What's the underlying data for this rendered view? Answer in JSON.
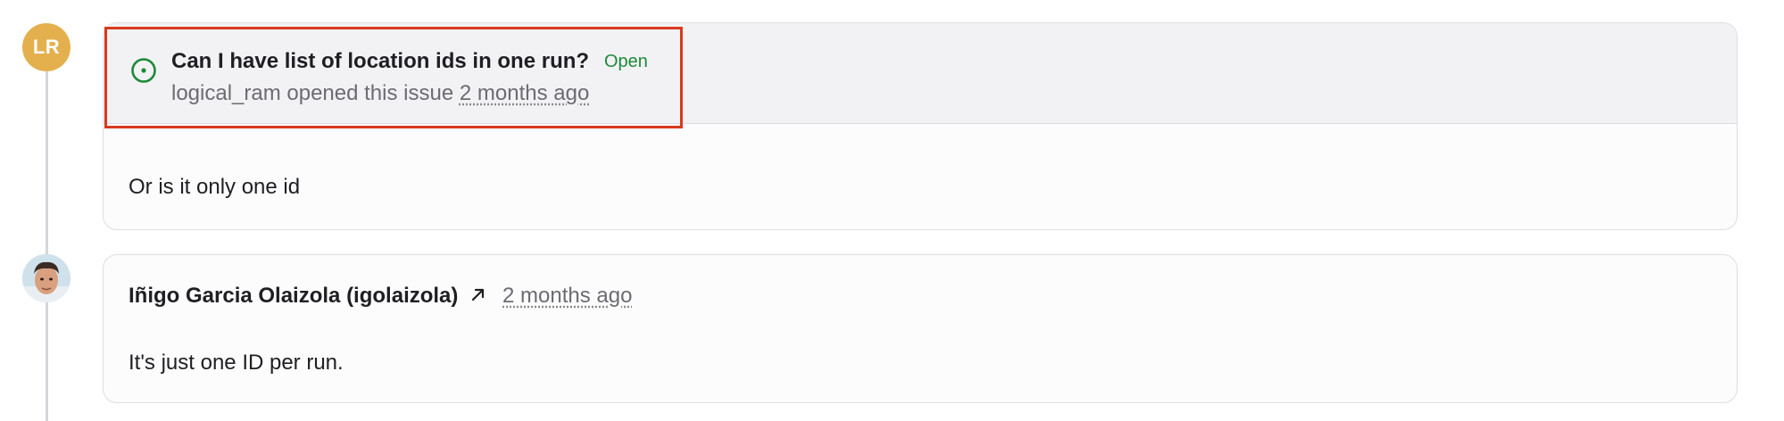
{
  "issue": {
    "author_initials": "LR",
    "title": "Can I have list of location ids in one run?",
    "status": "Open",
    "meta_prefix": "logical_ram opened this issue",
    "time_ago": "2 months ago",
    "body": "Or is it only one id"
  },
  "comment": {
    "author": "Iñigo Garcia Olaizola (igolaizola)",
    "time_ago": "2 months ago",
    "body": "It's just one ID per run."
  },
  "colors": {
    "status_open": "#1c8a38",
    "highlight": "#d9391e",
    "avatar_bg": "#e4b04e"
  },
  "icons": {
    "status": "issue-open-icon",
    "external": "external-link-icon"
  }
}
